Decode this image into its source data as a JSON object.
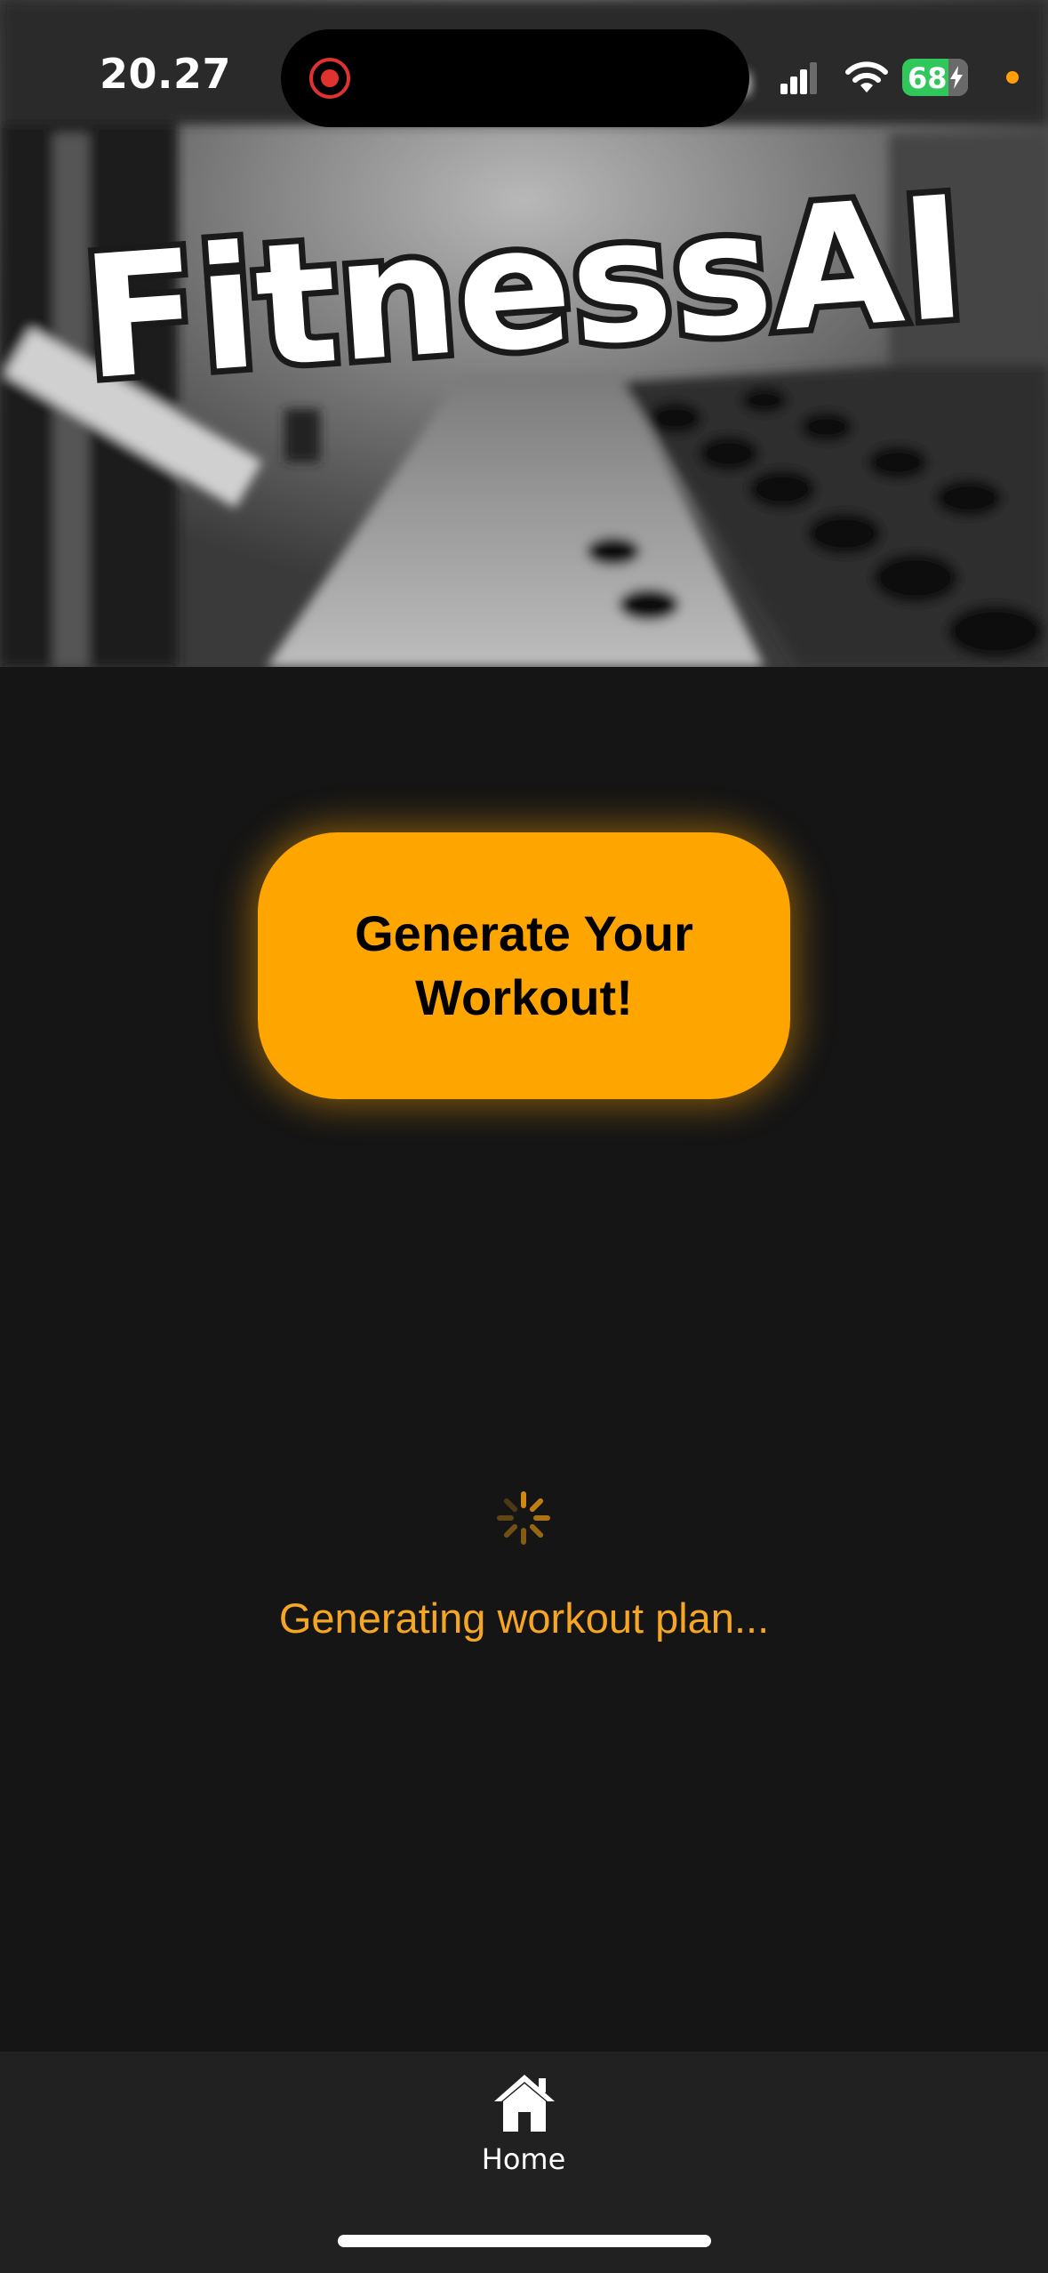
{
  "status_bar": {
    "time": "20.27",
    "battery_level": "68"
  },
  "hero": {
    "app_title": "FitnessAI"
  },
  "main": {
    "generate_button_label": "Generate Your Workout!",
    "loading_text": "Generating workout plan..."
  },
  "tab_bar": {
    "items": [
      {
        "label": "Home",
        "icon": "home-icon",
        "selected": true
      }
    ]
  },
  "colors": {
    "accent": "#ffa500",
    "loading_text": "#f5a623",
    "background": "#151515",
    "tab_bar": "#212121"
  }
}
